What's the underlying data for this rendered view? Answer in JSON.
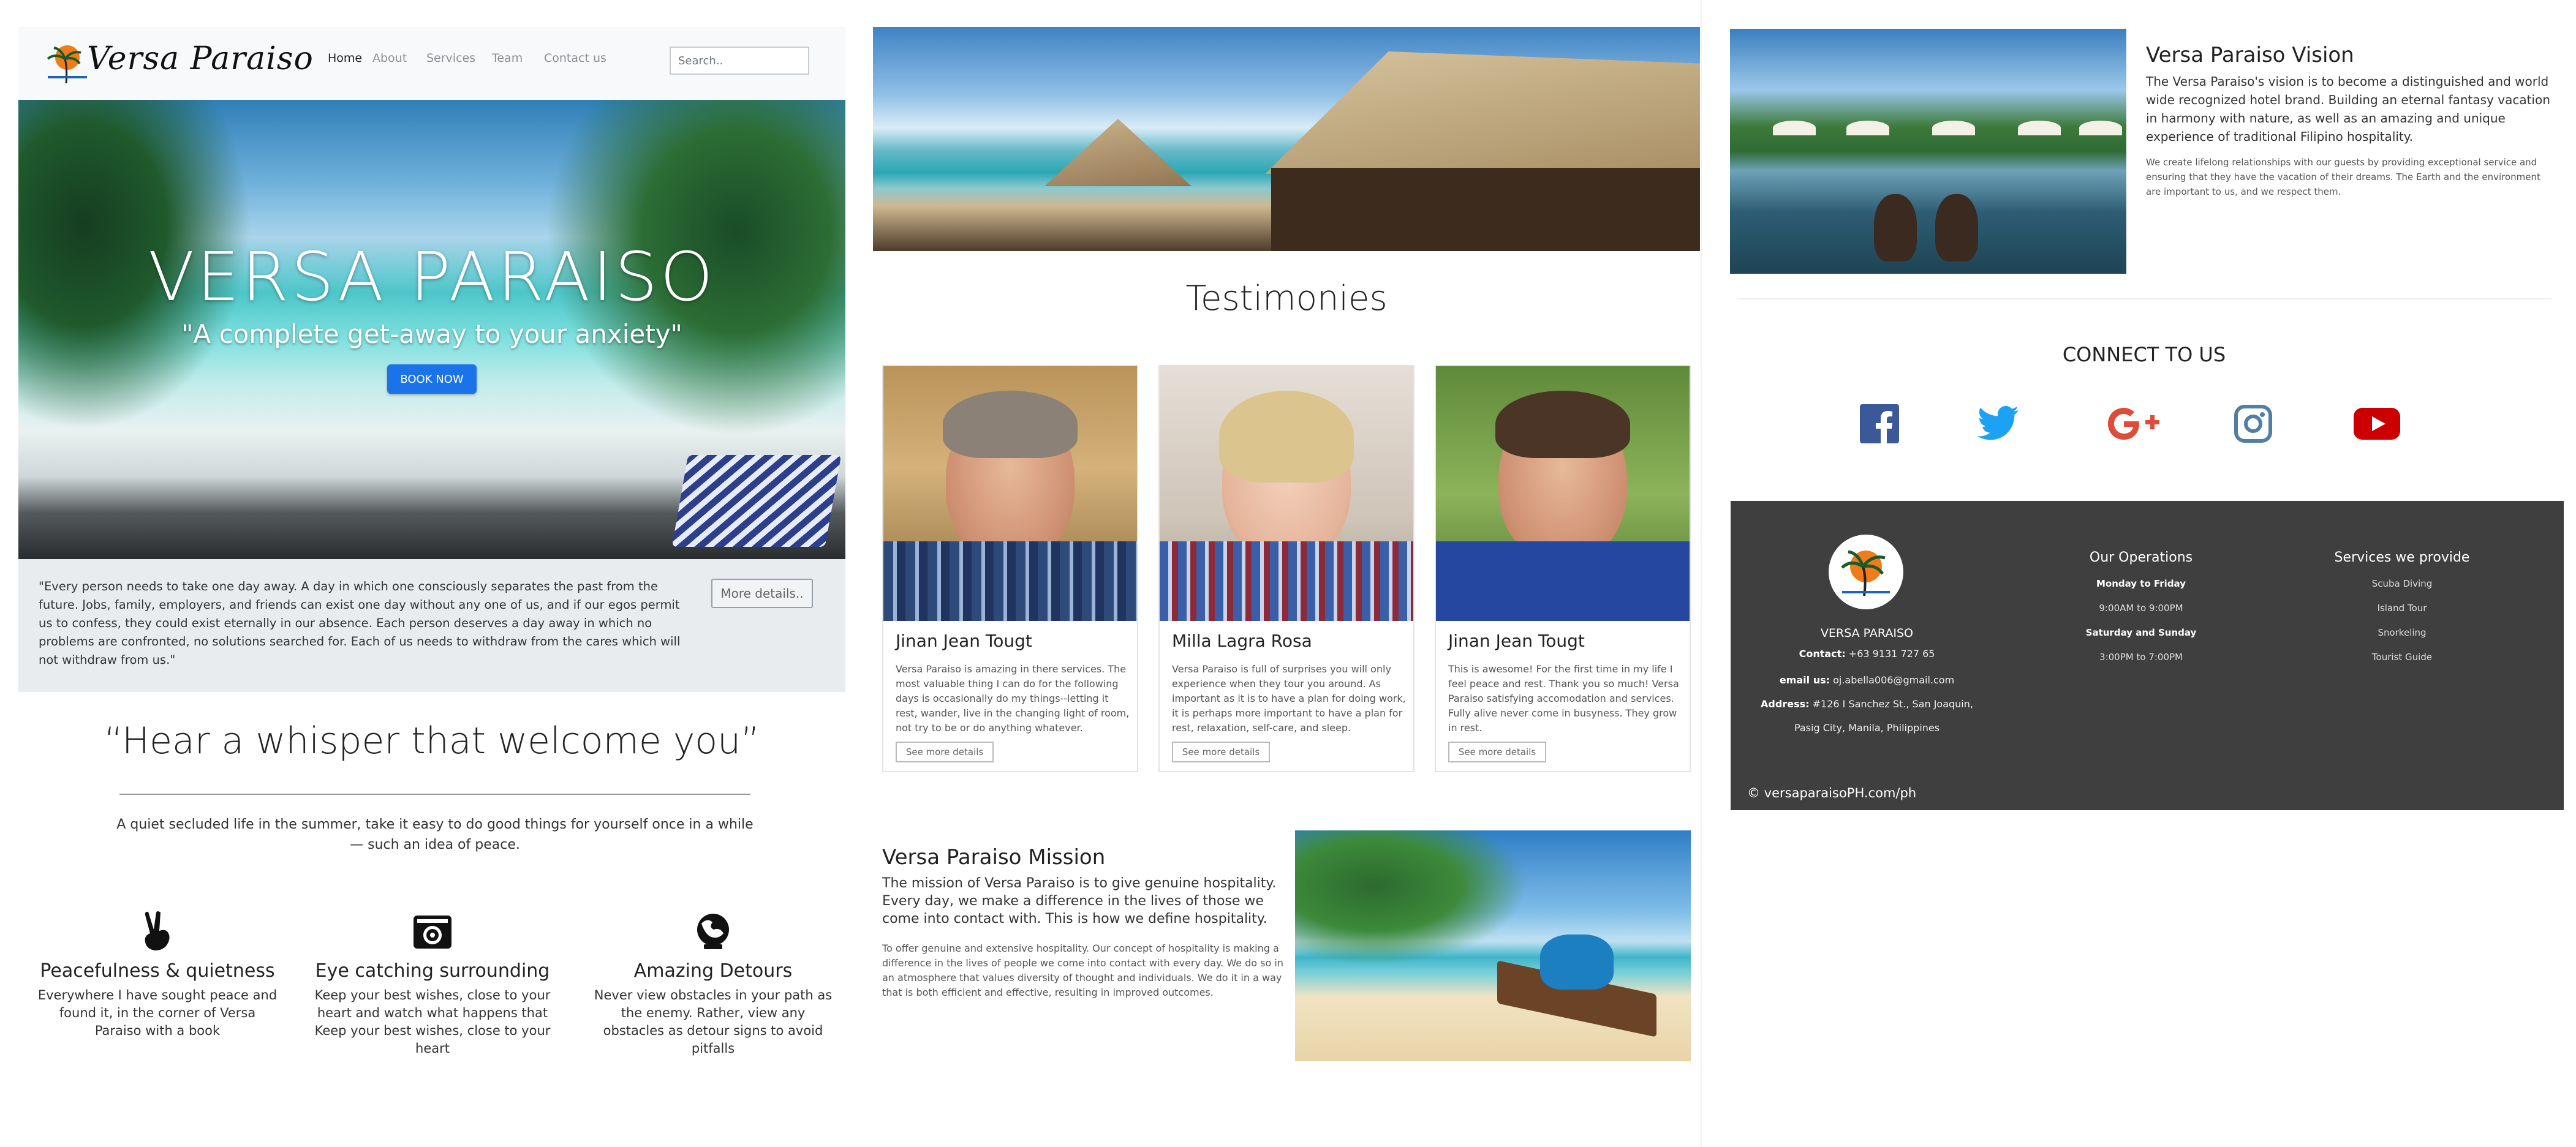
{
  "brand": "Versa Paraiso",
  "nav": [
    "Home",
    "About",
    "Services",
    "Team",
    "Contact us"
  ],
  "search_placeholder": "Search..",
  "hero": {
    "title": "VERSA PARAISO",
    "subtitle": "\"A complete get-away to your anxiety\"",
    "button": "BOOK NOW"
  },
  "quote": {
    "text": "\"Every person needs to take one day away. A day in which one consciously separates the past from the future. Jobs, family, employers, and friends can exist one day without any one of us, and if our egos permit us to confess, they could exist eternally in our absence. Each person deserves a day away in which no problems are confronted, no solutions searched for. Each of us needs to withdraw from the cares which will not withdraw from us.\"",
    "button": "More details.."
  },
  "whisper": {
    "title": "“Hear a whisper that welcome you”",
    "text": "A quiet secluded life in the summer, take it easy to do good things for yourself once in a while — such an idea of peace."
  },
  "features": [
    {
      "icon": "peace-hand-icon",
      "title": "Peacefulness & quietness",
      "text": "Everywhere I have sought peace and found it, in the corner of Versa Paraiso with a book"
    },
    {
      "icon": "camera-icon",
      "title": "Eye catching surrounding",
      "text": "Keep your best wishes, close to your heart and watch what happens that Keep your best wishes, close to your heart"
    },
    {
      "icon": "globe-map-icon",
      "title": "Amazing Detours",
      "text": "Never view obstacles in your path as the enemy. Rather, view any obstacles as detour signs to avoid pitfalls"
    }
  ],
  "testimonies": {
    "title": "Testimonies",
    "cards": [
      {
        "name": "Jinan Jean Tougt",
        "text": "Versa Paraiso is amazing in there services. The most valuable thing I can do for the following days is occasionally do my things--letting it rest, wander, live in the changing light of room, not try to be or do anything whatever.",
        "button": "See more details"
      },
      {
        "name": "Milla Lagra Rosa",
        "text": "Versa Paraiso is full of surprises you will only experience when they tour you around. As important as it is to have a plan for doing work, it is perhaps more important to have a plan for rest, relaxation, self-care, and sleep.",
        "button": "See more details"
      },
      {
        "name": "Jinan Jean Tougt",
        "text": "This is awesome! For the first time in my life I feel peace and rest. Thank you so much! Versa Paraiso satisfying accomodation and services. Fully alive never come in busyness. They grow in rest.",
        "button": "See more details"
      }
    ]
  },
  "mission": {
    "title": "Versa Paraiso Mission",
    "lead": "The mission of Versa Paraiso is to give genuine hospitality. Every day, we make a difference in the lives of those we come into contact with. This is how we define hospitality.",
    "text": "To offer genuine and extensive hospitality. Our concept of hospitality is making a difference in the lives of people we come into contact with every day. We do so in an atmosphere that values diversity of thought and individuals. We do it in a way that is both efficient and effective, resulting in improved outcomes."
  },
  "vision": {
    "title": "Versa Paraiso Vision",
    "lead": "The Versa Paraiso's vision is to become a distinguished and world wide recognized hotel brand. Building an eternal fantasy vacation in harmony with nature, as well as an amazing and unique experience of traditional Filipino hospitality.",
    "text": "We create lifelong relationships with our guests by providing exceptional service and ensuring that they have the vacation of their dreams. The Earth and the environment are important to us, and we respect them."
  },
  "connect": {
    "title": "CONNECT TO US",
    "icons": [
      "facebook-icon",
      "twitter-icon",
      "google-plus-icon",
      "instagram-icon",
      "youtube-icon"
    ],
    "colors": {
      "facebook": "#3b5998",
      "twitter": "#1da1f2",
      "google_plus": "#dd4b39",
      "instagram": "#517fa4",
      "youtube": "#cc0000"
    }
  },
  "footer": {
    "name": "VERSA PARAISO",
    "contact_label": "Contact:",
    "contact": "+63 9131 727 65",
    "email_label": "email us:",
    "email": "oj.abella006@gmail.com",
    "address_label": "Address:",
    "address1": "#126 I Sanchez St., San Joaquin,",
    "address2": "Pasig City, Manila, Philippines",
    "operations": {
      "title": "Our Operations",
      "lines": [
        "Monday to Friday",
        "9:00AM to 9:00PM",
        "Saturday and Sunday",
        "3:00PM to 7:00PM"
      ]
    },
    "services": {
      "title": "Services we provide",
      "lines": [
        "Scuba Diving",
        "Island Tour",
        "Snorkeling",
        "Tourist Guide"
      ]
    },
    "copyright": "© versaparaisoPH.com/ph"
  },
  "colors": {
    "accent": "#1a73e8",
    "footer_bg": "#3f3f3f",
    "navbar_bg": "#f8f9fa",
    "quote_bg": "#e8ecef"
  }
}
